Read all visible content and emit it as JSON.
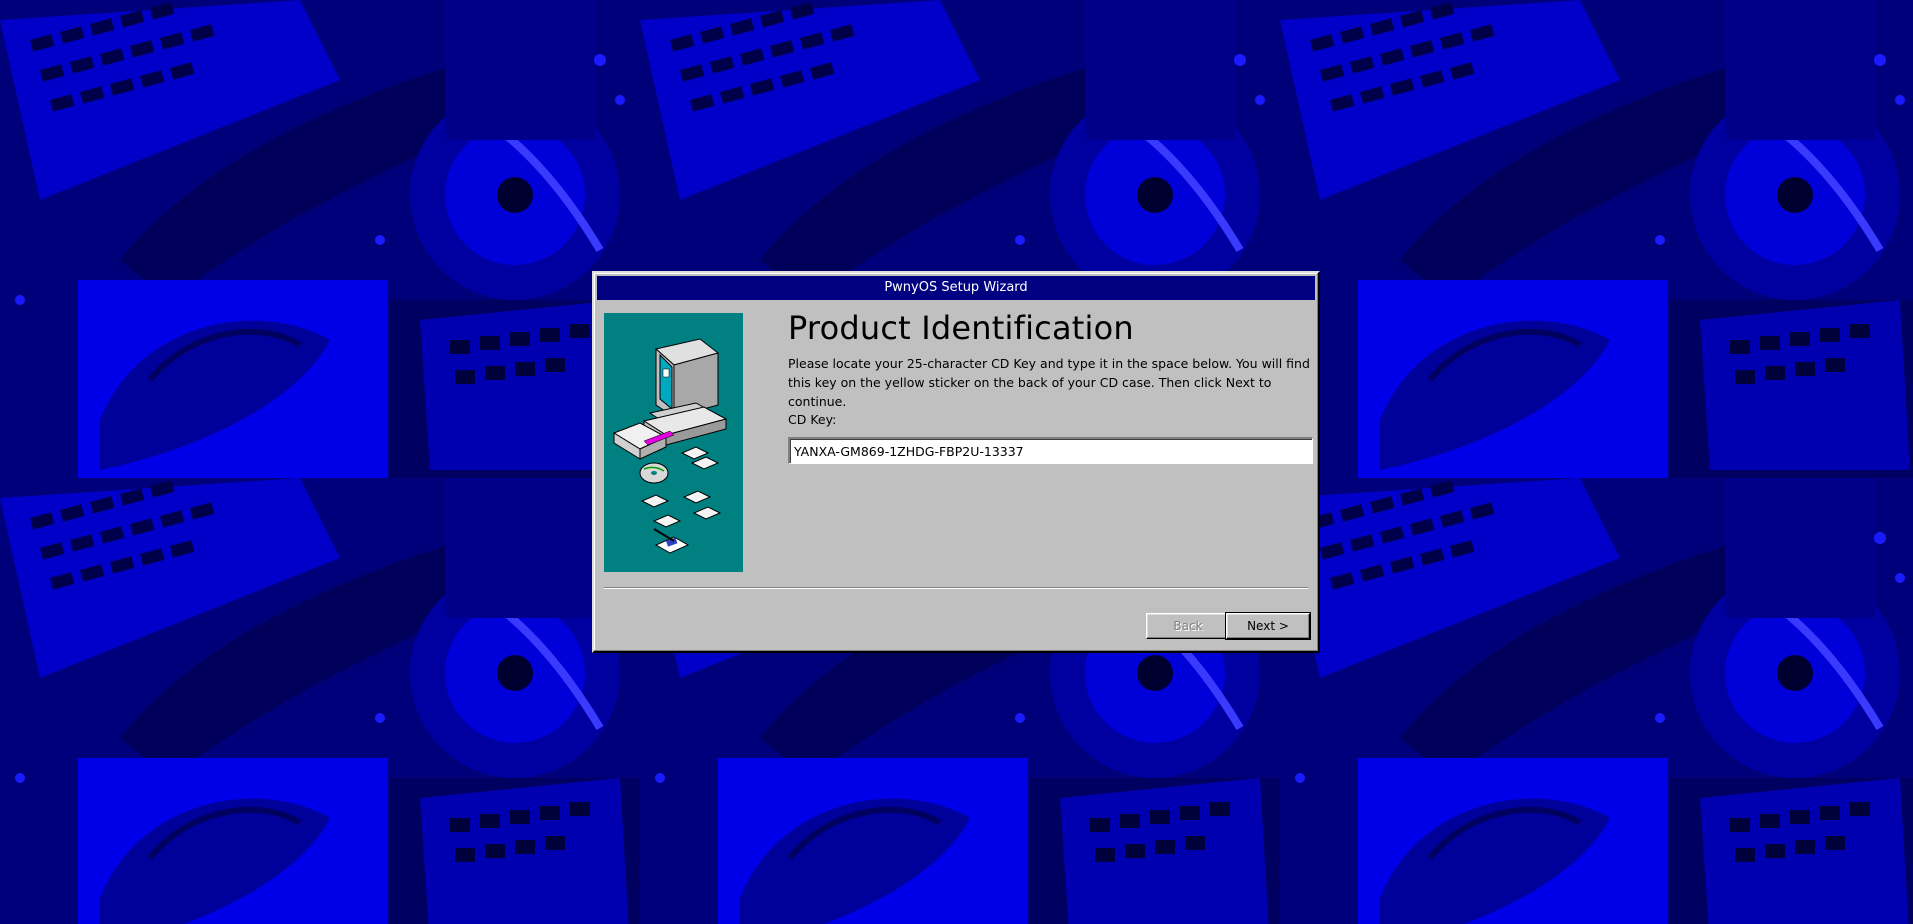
{
  "window": {
    "title": "PwnyOS Setup Wizard"
  },
  "page": {
    "heading": "Product Identification",
    "instructions": "Please locate your 25-character CD Key and type it in the space below. You will find this key on the yellow sticker on the back of your CD case. Then click Next to continue.",
    "cd_key_label": "CD Key:",
    "cd_key_value": "YANXA-GM869-1ZHDG-FBP2U-13337"
  },
  "buttons": {
    "back_label": "Back",
    "next_label": "Next >",
    "back_enabled": false
  },
  "colors": {
    "desktop": "#0000ff",
    "desktop_dark": "#00006b",
    "titlebar": "#000080",
    "dialog_face": "#c0c0c0",
    "art_panel": "#008080"
  },
  "icons": {
    "side_art": "computer-with-disks-illustration"
  }
}
